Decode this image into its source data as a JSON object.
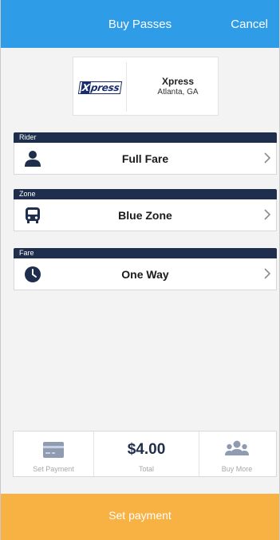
{
  "header": {
    "title": "Buy Passes",
    "cancel_label": "Cancel"
  },
  "agency": {
    "logo_text_x": "X",
    "logo_text_rest": "press",
    "name": "Xpress",
    "location": "Atlanta, GA"
  },
  "sections": [
    {
      "label": "Rider",
      "value": "Full Fare",
      "icon": "person-icon"
    },
    {
      "label": "Zone",
      "value": "Blue Zone",
      "icon": "bus-icon"
    },
    {
      "label": "Fare",
      "value": "One Way",
      "icon": "clock-icon"
    }
  ],
  "summary": {
    "payment_label": "Set Payment",
    "price": "$4.00",
    "total_label": "Total",
    "buy_more_label": "Buy More"
  },
  "footer": {
    "button_label": "Set payment"
  },
  "colors": {
    "header": "#2f9ce8",
    "navy": "#1f2e4c",
    "button": "#f8b143"
  }
}
